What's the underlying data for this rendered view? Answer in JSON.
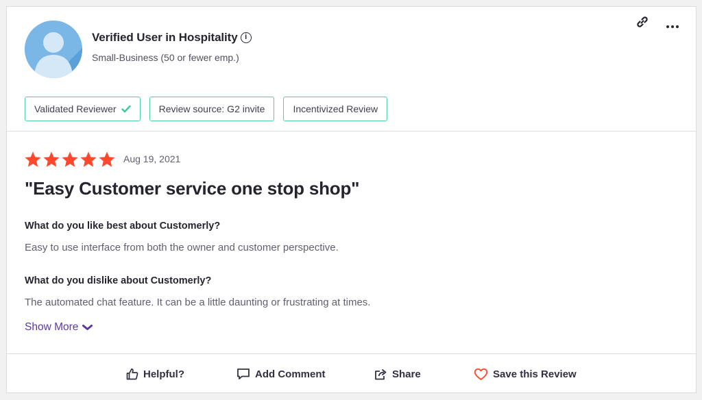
{
  "reviewer": {
    "name": "Verified User in Hospitality",
    "info_icon": "info-circle-icon",
    "company_size": "Small-Business (50 or fewer emp.)",
    "avatar_bg": "#7ab7e6"
  },
  "header_icons": [
    "link-icon",
    "more-options-icon"
  ],
  "badges": [
    {
      "label": "Validated Reviewer",
      "icon": "check-icon"
    },
    {
      "label": "Review source: G2 invite"
    },
    {
      "label": "Incentivized Review"
    }
  ],
  "badge_border_color": "#4cd3a5",
  "review": {
    "rating": 5,
    "max_rating": 5,
    "star_color": "#ff492c",
    "date": "Aug 19, 2021",
    "title": "\"Easy Customer service one stop shop\"",
    "q1": "What do you like best about Customerly?",
    "a1": "Easy to use interface from both the owner and customer perspective.",
    "q2": "What do you dislike about Customerly?",
    "a2": "The automated chat feature. It can be a little daunting or frustrating at times.",
    "show_more": "Show More"
  },
  "accent_color": "#5a39a2",
  "actions": {
    "helpful": "Helpful?",
    "comment": "Add Comment",
    "share": "Share",
    "save": "Save this Review"
  }
}
